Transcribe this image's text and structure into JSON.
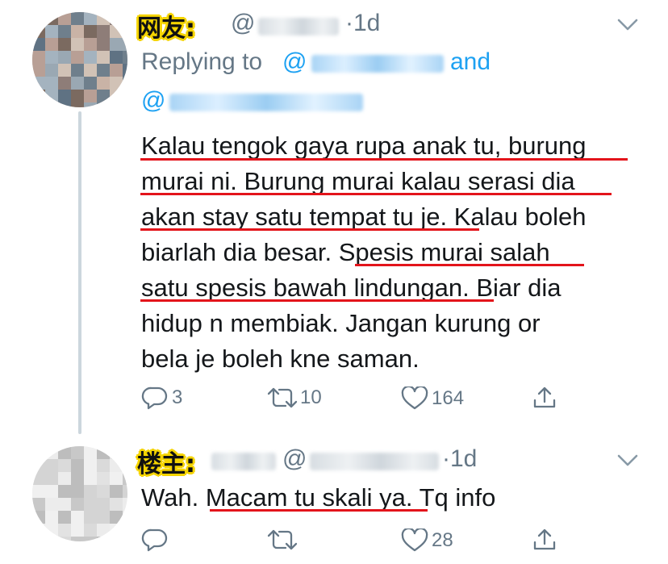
{
  "tweets": [
    {
      "tag": "网友:",
      "handle": "@",
      "time": "·1d",
      "replying_prefix": "Replying to",
      "replying_handle1": "@",
      "replying_and": "and",
      "replying_handle2": "@",
      "lines": [
        "Kalau tengok gaya rupa anak tu, burung",
        "murai ni. Burung murai kalau serasi dia",
        "akan stay satu tempat tu je. Kalau boleh",
        "biarlah dia besar. Spesis murai salah",
        "satu spesis bawah lindungan. Biar dia",
        "hidup n membiak. Jangan kurung or",
        "bela je boleh kne saman."
      ],
      "actions": {
        "reply_count": "3",
        "retweet_count": "10",
        "like_count": "164"
      }
    },
    {
      "tag": "楼主:",
      "handle": "@",
      "time": "·1d",
      "line_prefix": "Wah. ",
      "line_highlight": "Macam tu skali ya",
      "line_suffix": ". Tq info",
      "actions": {
        "reply_count": "",
        "retweet_count": "",
        "like_count": "28"
      }
    }
  ],
  "icons": {
    "reply": "reply-icon",
    "retweet": "retweet-icon",
    "like": "heart-icon",
    "share": "share-icon",
    "more": "chevron-down-icon"
  },
  "colors": {
    "link": "#1da1f2",
    "muted": "#657786",
    "underline": "#e3141b",
    "tag_highlight": "#f5d400"
  }
}
